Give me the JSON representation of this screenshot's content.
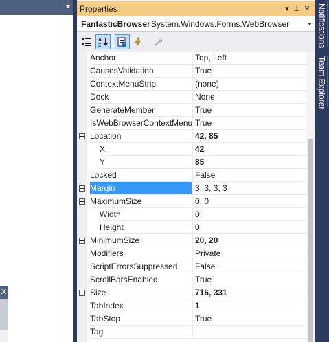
{
  "properties_window": {
    "title": "Properties",
    "title_buttons": {
      "dropdown": "▾",
      "pin": "⊥",
      "close": "✕"
    },
    "object_name": "FantasticBrowser",
    "object_type": "System.Windows.Forms.WebBrowser",
    "toolbar": {
      "categorized": "categorized-icon",
      "alphabetical": "alphabetical-icon",
      "properties": "properties-icon",
      "events": "events-icon",
      "property_pages": "property-pages-icon"
    },
    "rows": [
      {
        "name": "Anchor",
        "value": "Top, Left"
      },
      {
        "name": "CausesValidation",
        "value": "True"
      },
      {
        "name": "ContextMenuStrip",
        "value": "(none)"
      },
      {
        "name": "Dock",
        "value": "None"
      },
      {
        "name": "GenerateMember",
        "value": "True"
      },
      {
        "name": "IsWebBrowserContextMenu",
        "value": "True"
      },
      {
        "name": "Location",
        "value": "42, 85"
      },
      {
        "name": "X",
        "value": "42"
      },
      {
        "name": "Y",
        "value": "85"
      },
      {
        "name": "Locked",
        "value": "False"
      },
      {
        "name": "Margin",
        "value": "3, 3, 3, 3"
      },
      {
        "name": "MaximumSize",
        "value": "0, 0"
      },
      {
        "name": "Width",
        "value": "0"
      },
      {
        "name": "Height",
        "value": "0"
      },
      {
        "name": "MinimumSize",
        "value": "20, 20"
      },
      {
        "name": "Modifiers",
        "value": "Private"
      },
      {
        "name": "ScriptErrorsSuppressed",
        "value": "False"
      },
      {
        "name": "ScrollBarsEnabled",
        "value": "True"
      },
      {
        "name": "Size",
        "value": "716, 331"
      },
      {
        "name": "TabIndex",
        "value": "1"
      },
      {
        "name": "TabStop",
        "value": "True"
      },
      {
        "name": "Tag",
        "value": ""
      }
    ]
  },
  "side_tabs": {
    "notifications": "Notifications",
    "team_explorer": "Team Explorer"
  },
  "left_pane": {
    "float_close": "✕"
  },
  "colors": {
    "title_active": "#f5cc84",
    "selection": "#3399ff",
    "chrome": "#2e3b5e"
  }
}
